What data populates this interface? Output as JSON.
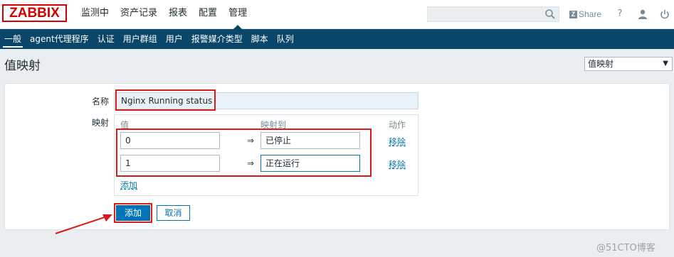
{
  "header": {
    "logo": "ZABBIX",
    "nav": [
      "监测中",
      "资产记录",
      "报表",
      "配置",
      "管理"
    ],
    "share": "Share",
    "share_logo": "Z",
    "help": "?",
    "icons": [
      "search-icon",
      "user-icon",
      "power-icon"
    ]
  },
  "subnav": [
    "一般",
    "agent代理程序",
    "认证",
    "用户群组",
    "用户",
    "报警媒介类型",
    "脚本",
    "队列"
  ],
  "page": {
    "title": "值映射",
    "select_value": "值映射"
  },
  "form": {
    "name_label": "名称",
    "name_value": "Nginx Running status",
    "mapping_label": "映射",
    "columns": {
      "value": "值",
      "mapped_to": "映射到",
      "action": "动作"
    },
    "rows": [
      {
        "value": "0",
        "arrow": "⇒",
        "mapped": "已停止",
        "remove": "移除"
      },
      {
        "value": "1",
        "arrow": "⇒",
        "mapped": "正在运行",
        "remove": "移除"
      }
    ],
    "add_link": "添加",
    "add_button": "添加",
    "cancel_button": "取消"
  },
  "watermark": "@51CTO博客",
  "colors": {
    "brand": "#d40000",
    "nav": "#0a466a",
    "primary": "#0275b8",
    "highlight": "#d91b1b"
  }
}
